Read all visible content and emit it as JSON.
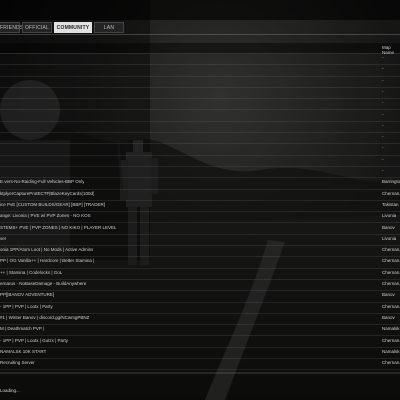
{
  "tabs": [
    {
      "label": "FRIENDS",
      "active": false
    },
    {
      "label": "OFFICIAL",
      "active": false
    },
    {
      "label": "COMMUNITY",
      "active": true
    },
    {
      "label": "LAN",
      "active": false
    }
  ],
  "columns": {
    "map": "Map Name"
  },
  "servers": [
    {
      "name": "",
      "map": "-"
    },
    {
      "name": "",
      "map": "-"
    },
    {
      "name": "",
      "map": "-"
    },
    {
      "name": "",
      "map": "-"
    },
    {
      "name": "",
      "map": "-"
    },
    {
      "name": "",
      "map": "-"
    },
    {
      "name": "",
      "map": "-"
    },
    {
      "name": "",
      "map": "-"
    },
    {
      "name": "",
      "map": "-"
    },
    {
      "name": "",
      "map": "-"
    },
    {
      "name": "",
      "map": "-"
    },
    {
      "name": "E.vers-No-Raiding-Full Vehicles-BBP Only",
      "map": "Barrington"
    },
    {
      "name": "ktplyerCaptureProtECTF|BlazeKeyCards(100d)",
      "map": "Chernarus"
    },
    {
      "name": "ice PvE [CUSTOM BUILDS/GEAR] [BBP] [TRADER]",
      "map": "Takistan"
    },
    {
      "name": "ange: Livonia | PVE w/ PVP Zones - NO KOS",
      "map": "Livonia"
    },
    {
      "name": "STEMS+ PVE | PVP ZONES | NO KIKO | PLAYER LEVEL",
      "map": "Banov"
    },
    {
      "name": "ver",
      "map": "Livonia"
    },
    {
      "name": "onia 1PP/Atom Loot | No Mods | Active Admins",
      "map": "Chernarus"
    },
    {
      "name": "PP | OG Vanilla++ | Hardcore | Better Stamina |",
      "map": "Chernarus"
    },
    {
      "name": "++ | Stamina | Codelocks | GoL",
      "map": "Chernarus"
    },
    {
      "name": "ernarus - NoBaseDamage - BuildAnywhere",
      "map": "Chernarus"
    },
    {
      "name": "PP[|BANOV ADVENTURE]",
      "map": "Banov"
    },
    {
      "name": "- 1PP | PVP | Lootx | Party",
      "map": "Chernarus"
    },
    {
      "name": "#1 | Winter Banov | discord.gg/NCwmgPBNZ",
      "map": "Banov"
    },
    {
      "name": "M | Deathmatch PVP |",
      "map": "Namalsk"
    },
    {
      "name": "- 1PP | PVP | Lootx | Gutzx | Party",
      "map": "Chernarus"
    },
    {
      "name": "NAMALSK 10K START",
      "map": "Namalsk"
    },
    {
      "name": "Recruiting Server",
      "map": "Chernarus"
    }
  ],
  "footer": {
    "text": "Loading..."
  }
}
